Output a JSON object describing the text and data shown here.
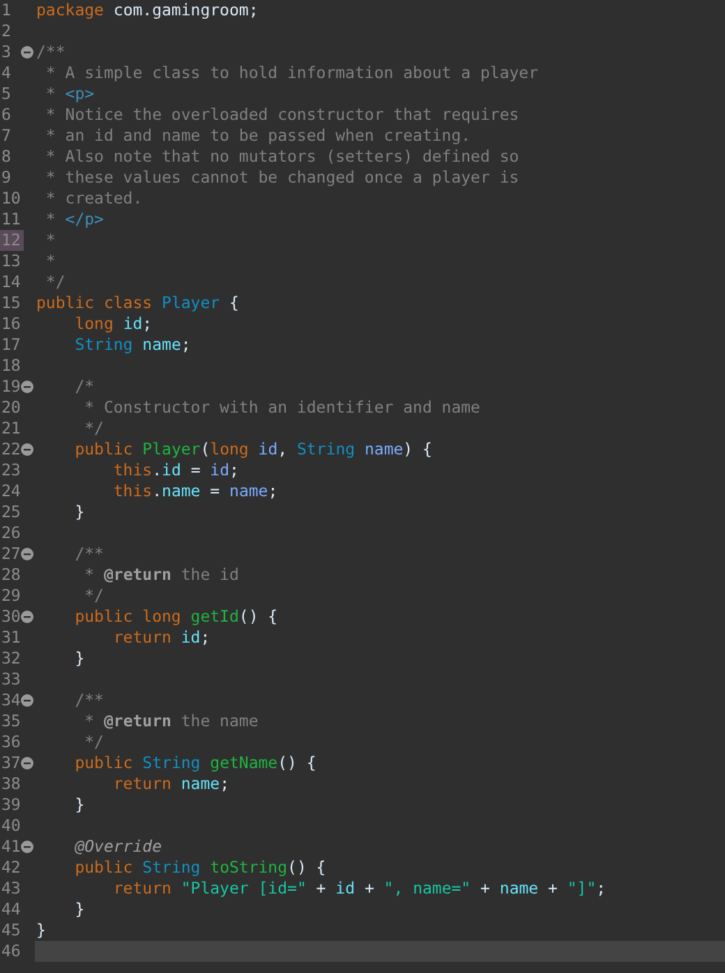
{
  "editor": {
    "lines": [
      {
        "number": "1",
        "fold": false,
        "marked": false,
        "current": false,
        "tokens": [
          {
            "text": "package",
            "kind": "kw"
          },
          {
            "text": " com.gamingroom;",
            "kind": "plain"
          }
        ]
      },
      {
        "number": "2",
        "fold": false,
        "marked": false,
        "current": false
      },
      {
        "number": "3",
        "fold": true,
        "marked": false,
        "current": false,
        "tokens": [
          {
            "text": "/**",
            "kind": "comment"
          }
        ]
      },
      {
        "number": "4",
        "fold": false,
        "marked": false,
        "current": false,
        "tokens": [
          {
            "text": " * A simple class to hold information about a player",
            "kind": "comment"
          }
        ]
      },
      {
        "number": "5",
        "fold": false,
        "marked": false,
        "current": false,
        "tokens": [
          {
            "text": " * ",
            "kind": "comment"
          },
          {
            "text": "<p>",
            "kind": "tag"
          }
        ]
      },
      {
        "number": "6",
        "fold": false,
        "marked": false,
        "current": false,
        "tokens": [
          {
            "text": " * Notice the overloaded constructor that requires",
            "kind": "comment"
          }
        ]
      },
      {
        "number": "7",
        "fold": false,
        "marked": false,
        "current": false,
        "tokens": [
          {
            "text": " * an id and name to be passed when creating.",
            "kind": "comment"
          }
        ]
      },
      {
        "number": "8",
        "fold": false,
        "marked": false,
        "current": false,
        "tokens": [
          {
            "text": " * Also note that no mutators (setters) defined so",
            "kind": "comment"
          }
        ]
      },
      {
        "number": "9",
        "fold": false,
        "marked": false,
        "current": false,
        "tokens": [
          {
            "text": " * these values cannot be changed once a player is",
            "kind": "comment"
          }
        ]
      },
      {
        "number": "10",
        "fold": false,
        "marked": false,
        "current": false,
        "tokens": [
          {
            "text": " * created.",
            "kind": "comment"
          }
        ]
      },
      {
        "number": "11",
        "fold": false,
        "marked": false,
        "current": false,
        "tokens": [
          {
            "text": " * ",
            "kind": "comment"
          },
          {
            "text": "</p>",
            "kind": "tag"
          }
        ]
      },
      {
        "number": "12",
        "fold": false,
        "marked": true,
        "current": false,
        "tokens": [
          {
            "text": " *",
            "kind": "comment"
          }
        ]
      },
      {
        "number": "13",
        "fold": false,
        "marked": false,
        "current": false,
        "tokens": [
          {
            "text": " *",
            "kind": "comment"
          }
        ]
      },
      {
        "number": "14",
        "fold": false,
        "marked": false,
        "current": false,
        "tokens": [
          {
            "text": " */",
            "kind": "comment"
          }
        ]
      },
      {
        "number": "15",
        "fold": false,
        "marked": false,
        "current": false,
        "tokens": [
          {
            "text": "public class",
            "kind": "kw"
          },
          {
            "text": " Player",
            "kind": "type"
          },
          {
            "text": " {",
            "kind": "plain"
          }
        ]
      },
      {
        "number": "16",
        "fold": false,
        "marked": false,
        "current": false,
        "tokens": [
          {
            "text": "    long",
            "kind": "kw"
          },
          {
            "text": " id",
            "kind": "field"
          },
          {
            "text": ";",
            "kind": "plain"
          }
        ]
      },
      {
        "number": "17",
        "fold": false,
        "marked": false,
        "current": false,
        "tokens": [
          {
            "text": "    String",
            "kind": "type"
          },
          {
            "text": " name",
            "kind": "field"
          },
          {
            "text": ";",
            "kind": "plain"
          }
        ]
      },
      {
        "number": "18",
        "fold": false,
        "marked": false,
        "current": false
      },
      {
        "number": "19",
        "fold": true,
        "marked": false,
        "current": false,
        "tokens": [
          {
            "text": "    /*",
            "kind": "comment"
          }
        ]
      },
      {
        "number": "20",
        "fold": false,
        "marked": false,
        "current": false,
        "tokens": [
          {
            "text": "     * Constructor with an identifier and name",
            "kind": "comment"
          }
        ]
      },
      {
        "number": "21",
        "fold": false,
        "marked": false,
        "current": false,
        "tokens": [
          {
            "text": "     */",
            "kind": "comment"
          }
        ]
      },
      {
        "number": "22",
        "fold": true,
        "marked": false,
        "current": false,
        "tokens": [
          {
            "text": "    public",
            "kind": "kw"
          },
          {
            "text": " Player",
            "kind": "method"
          },
          {
            "text": "(",
            "kind": "plain"
          },
          {
            "text": "long",
            "kind": "kw"
          },
          {
            "text": " id",
            "kind": "param"
          },
          {
            "text": ", ",
            "kind": "plain"
          },
          {
            "text": "String",
            "kind": "type"
          },
          {
            "text": " name",
            "kind": "param"
          },
          {
            "text": ") {",
            "kind": "plain"
          }
        ]
      },
      {
        "number": "23",
        "fold": false,
        "marked": false,
        "current": false,
        "tokens": [
          {
            "text": "        this",
            "kind": "kw"
          },
          {
            "text": ".",
            "kind": "plain"
          },
          {
            "text": "id",
            "kind": "field"
          },
          {
            "text": " = ",
            "kind": "plain"
          },
          {
            "text": "id",
            "kind": "param"
          },
          {
            "text": ";",
            "kind": "plain"
          }
        ]
      },
      {
        "number": "24",
        "fold": false,
        "marked": false,
        "current": false,
        "tokens": [
          {
            "text": "        this",
            "kind": "kw"
          },
          {
            "text": ".",
            "kind": "plain"
          },
          {
            "text": "name",
            "kind": "field"
          },
          {
            "text": " = ",
            "kind": "plain"
          },
          {
            "text": "name",
            "kind": "param"
          },
          {
            "text": ";",
            "kind": "plain"
          }
        ]
      },
      {
        "number": "25",
        "fold": false,
        "marked": false,
        "current": false,
        "tokens": [
          {
            "text": "    }",
            "kind": "plain"
          }
        ]
      },
      {
        "number": "26",
        "fold": false,
        "marked": false,
        "current": false
      },
      {
        "number": "27",
        "fold": true,
        "marked": false,
        "current": false,
        "tokens": [
          {
            "text": "    /**",
            "kind": "comment"
          }
        ]
      },
      {
        "number": "28",
        "fold": false,
        "marked": false,
        "current": false,
        "tokens": [
          {
            "text": "     * ",
            "kind": "comment"
          },
          {
            "text": "@return",
            "kind": "doctag"
          },
          {
            "text": " the id",
            "kind": "comment"
          }
        ]
      },
      {
        "number": "29",
        "fold": false,
        "marked": false,
        "current": false,
        "tokens": [
          {
            "text": "     */",
            "kind": "comment"
          }
        ]
      },
      {
        "number": "30",
        "fold": true,
        "marked": false,
        "current": false,
        "tokens": [
          {
            "text": "    public long",
            "kind": "kw"
          },
          {
            "text": " getId",
            "kind": "method"
          },
          {
            "text": "() {",
            "kind": "plain"
          }
        ]
      },
      {
        "number": "31",
        "fold": false,
        "marked": false,
        "current": false,
        "tokens": [
          {
            "text": "        return",
            "kind": "kw"
          },
          {
            "text": " id",
            "kind": "field"
          },
          {
            "text": ";",
            "kind": "plain"
          }
        ]
      },
      {
        "number": "32",
        "fold": false,
        "marked": false,
        "current": false,
        "tokens": [
          {
            "text": "    }",
            "kind": "plain"
          }
        ]
      },
      {
        "number": "33",
        "fold": false,
        "marked": false,
        "current": false
      },
      {
        "number": "34",
        "fold": true,
        "marked": false,
        "current": false,
        "tokens": [
          {
            "text": "    /**",
            "kind": "comment"
          }
        ]
      },
      {
        "number": "35",
        "fold": false,
        "marked": false,
        "current": false,
        "tokens": [
          {
            "text": "     * ",
            "kind": "comment"
          },
          {
            "text": "@return",
            "kind": "doctag"
          },
          {
            "text": " the name",
            "kind": "comment"
          }
        ]
      },
      {
        "number": "36",
        "fold": false,
        "marked": false,
        "current": false,
        "tokens": [
          {
            "text": "     */",
            "kind": "comment"
          }
        ]
      },
      {
        "number": "37",
        "fold": true,
        "marked": false,
        "current": false,
        "tokens": [
          {
            "text": "    public",
            "kind": "kw"
          },
          {
            "text": " String",
            "kind": "type"
          },
          {
            "text": " getName",
            "kind": "method"
          },
          {
            "text": "() {",
            "kind": "plain"
          }
        ]
      },
      {
        "number": "38",
        "fold": false,
        "marked": false,
        "current": false,
        "tokens": [
          {
            "text": "        return",
            "kind": "kw"
          },
          {
            "text": " name",
            "kind": "field"
          },
          {
            "text": ";",
            "kind": "plain"
          }
        ]
      },
      {
        "number": "39",
        "fold": false,
        "marked": false,
        "current": false,
        "tokens": [
          {
            "text": "    }",
            "kind": "plain"
          }
        ]
      },
      {
        "number": "40",
        "fold": false,
        "marked": false,
        "current": false
      },
      {
        "number": "41",
        "fold": true,
        "marked": false,
        "current": false,
        "tokens": [
          {
            "text": "    @Override",
            "kind": "annotation"
          }
        ]
      },
      {
        "number": "42",
        "fold": false,
        "marked": false,
        "current": false,
        "tokens": [
          {
            "text": "    public",
            "kind": "kw"
          },
          {
            "text": " String",
            "kind": "type"
          },
          {
            "text": " toString",
            "kind": "method"
          },
          {
            "text": "() {",
            "kind": "plain"
          }
        ]
      },
      {
        "number": "43",
        "fold": false,
        "marked": false,
        "current": false,
        "tokens": [
          {
            "text": "        return",
            "kind": "kw"
          },
          {
            "text": " \"Player [id=\"",
            "kind": "str"
          },
          {
            "text": " + ",
            "kind": "plain"
          },
          {
            "text": "id",
            "kind": "field"
          },
          {
            "text": " + ",
            "kind": "plain"
          },
          {
            "text": "\", name=\"",
            "kind": "str"
          },
          {
            "text": " + ",
            "kind": "plain"
          },
          {
            "text": "name",
            "kind": "field"
          },
          {
            "text": " + ",
            "kind": "plain"
          },
          {
            "text": "\"]\"",
            "kind": "str"
          },
          {
            "text": ";",
            "kind": "plain"
          }
        ]
      },
      {
        "number": "44",
        "fold": false,
        "marked": false,
        "current": false,
        "tokens": [
          {
            "text": "    }",
            "kind": "plain"
          }
        ]
      },
      {
        "number": "45",
        "fold": false,
        "marked": false,
        "current": false,
        "tokens": [
          {
            "text": "}",
            "kind": "plain"
          }
        ]
      },
      {
        "number": "46",
        "fold": false,
        "marked": false,
        "current": true
      }
    ]
  }
}
